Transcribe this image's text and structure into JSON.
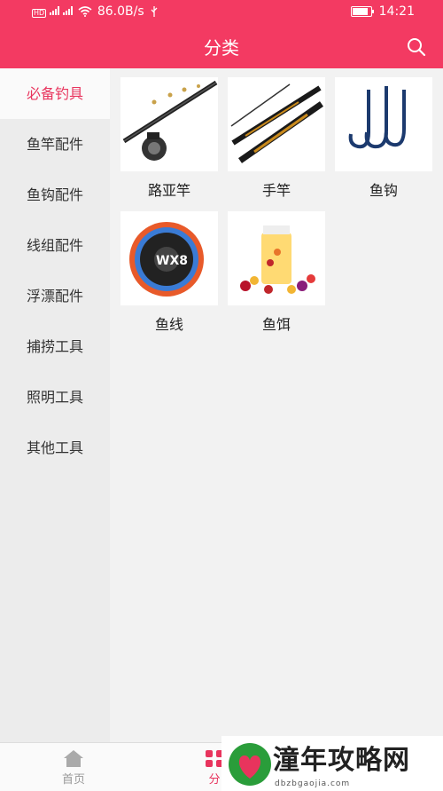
{
  "status": {
    "time": "14:21",
    "speed": "86.0B/s",
    "battery_level": 0.8
  },
  "header": {
    "title": "分类",
    "search_icon": "search-icon"
  },
  "sidebar": {
    "items": [
      {
        "label": "必备钓具",
        "active": true
      },
      {
        "label": "鱼竿配件"
      },
      {
        "label": "鱼钩配件"
      },
      {
        "label": "线组配件"
      },
      {
        "label": "浮漂配件"
      },
      {
        "label": "捕捞工具"
      },
      {
        "label": "照明工具"
      },
      {
        "label": "其他工具"
      }
    ]
  },
  "categories": [
    {
      "label": "路亚竿"
    },
    {
      "label": "手竿"
    },
    {
      "label": "鱼钩"
    },
    {
      "label": "鱼线"
    },
    {
      "label": "鱼饵"
    }
  ],
  "tabbar": {
    "home": "首页",
    "category": "分"
  },
  "watermark": {
    "text": "潼年攻略网",
    "url": "dbzbgaojia.com"
  },
  "colors": {
    "accent": "#f33a62",
    "active_text": "#e8345d"
  }
}
